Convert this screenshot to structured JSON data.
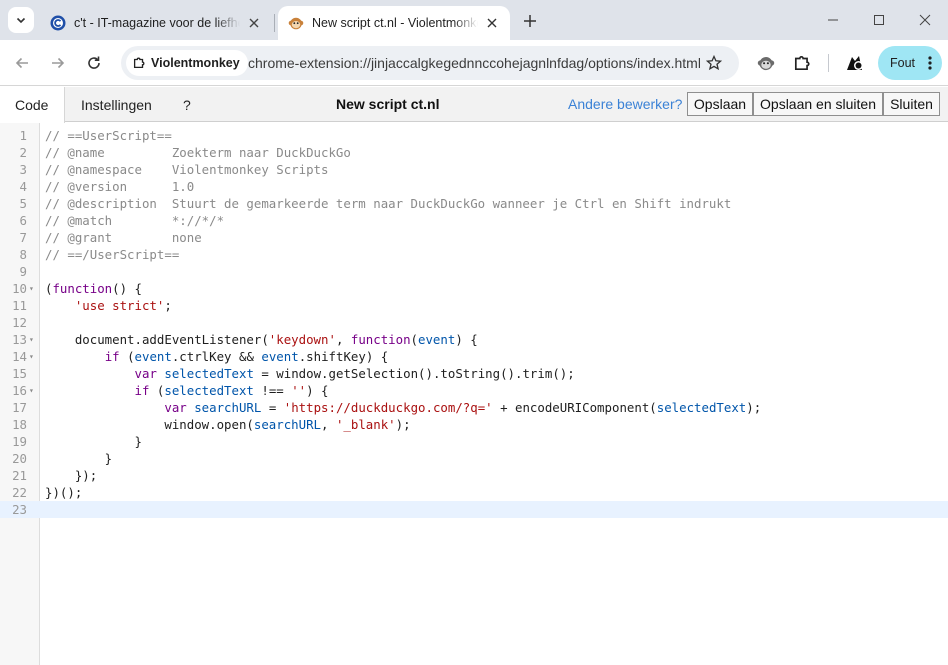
{
  "browser": {
    "tabs": [
      {
        "title": "c't - IT-magazine voor de liefhebber",
        "favicon": "ct-logo-icon",
        "active": false
      },
      {
        "title": "New script ct.nl - Violentmonkey",
        "favicon": "violentmonkey-icon",
        "active": true
      }
    ],
    "site_chip_label": "Violentmonkey",
    "url": "chrome-extension://jinjaccalgkegednnccohejagnlnfdag/options/index.html",
    "profile_label": "Fout",
    "accent_color": "#9fe6f4"
  },
  "editor": {
    "tabs": [
      "Code",
      "Instellingen",
      "?"
    ],
    "title": "New script ct.nl",
    "other_editor_link": "Andere bewerker?",
    "buttons": {
      "save": "Opslaan",
      "save_close": "Opslaan en sluiten",
      "close": "Sluiten"
    },
    "current_line": 23,
    "fold_lines": [
      10,
      13,
      14,
      16
    ],
    "lines": [
      [
        [
          "c",
          "// ==UserScript=="
        ]
      ],
      [
        [
          "c",
          "// @name         Zoekterm naar DuckDuckGo"
        ]
      ],
      [
        [
          "c",
          "// @namespace    Violentmonkey Scripts"
        ]
      ],
      [
        [
          "c",
          "// @version      1.0"
        ]
      ],
      [
        [
          "c",
          "// @description  Stuurt de gemarkeerde term naar DuckDuckGo wanneer je Ctrl en Shift indrukt"
        ]
      ],
      [
        [
          "c",
          "// @match        *://*/*"
        ]
      ],
      [
        [
          "c",
          "// @grant        none"
        ]
      ],
      [
        [
          "c",
          "// ==/UserScript=="
        ]
      ],
      [],
      [
        [
          "p",
          "("
        ],
        [
          "k",
          "function"
        ],
        [
          "p",
          "() {"
        ]
      ],
      [
        [
          "p",
          "    "
        ],
        [
          "s",
          "'use strict'"
        ],
        [
          "p",
          ";"
        ]
      ],
      [],
      [
        [
          "p",
          "    document.addEventListener("
        ],
        [
          "s",
          "'keydown'"
        ],
        [
          "p",
          ", "
        ],
        [
          "k",
          "function"
        ],
        [
          "p",
          "("
        ],
        [
          "v",
          "event"
        ],
        [
          "p",
          ") {"
        ]
      ],
      [
        [
          "p",
          "        "
        ],
        [
          "k",
          "if"
        ],
        [
          "p",
          " ("
        ],
        [
          "v",
          "event"
        ],
        [
          "p",
          ".ctrlKey && "
        ],
        [
          "v",
          "event"
        ],
        [
          "p",
          ".shiftKey) {"
        ]
      ],
      [
        [
          "p",
          "            "
        ],
        [
          "k",
          "var"
        ],
        [
          "p",
          " "
        ],
        [
          "v",
          "selectedText"
        ],
        [
          "p",
          " = window.getSelection().toString().trim();"
        ]
      ],
      [
        [
          "p",
          "            "
        ],
        [
          "k",
          "if"
        ],
        [
          "p",
          " ("
        ],
        [
          "v",
          "selectedText"
        ],
        [
          "p",
          " !== "
        ],
        [
          "s",
          "''"
        ],
        [
          "p",
          ") {"
        ]
      ],
      [
        [
          "p",
          "                "
        ],
        [
          "k",
          "var"
        ],
        [
          "p",
          " "
        ],
        [
          "v",
          "searchURL"
        ],
        [
          "p",
          " = "
        ],
        [
          "s",
          "'https://duckduckgo.com/?q='"
        ],
        [
          "p",
          " + encodeURIComponent("
        ],
        [
          "v",
          "selectedText"
        ],
        [
          "p",
          ");"
        ]
      ],
      [
        [
          "p",
          "                window.open("
        ],
        [
          "v",
          "searchURL"
        ],
        [
          "p",
          ", "
        ],
        [
          "s",
          "'_blank'"
        ],
        [
          "p",
          ");"
        ]
      ],
      [
        [
          "p",
          "            }"
        ]
      ],
      [
        [
          "p",
          "        }"
        ]
      ],
      [
        [
          "p",
          "    });"
        ]
      ],
      [
        [
          "p",
          "})();"
        ]
      ],
      []
    ]
  }
}
